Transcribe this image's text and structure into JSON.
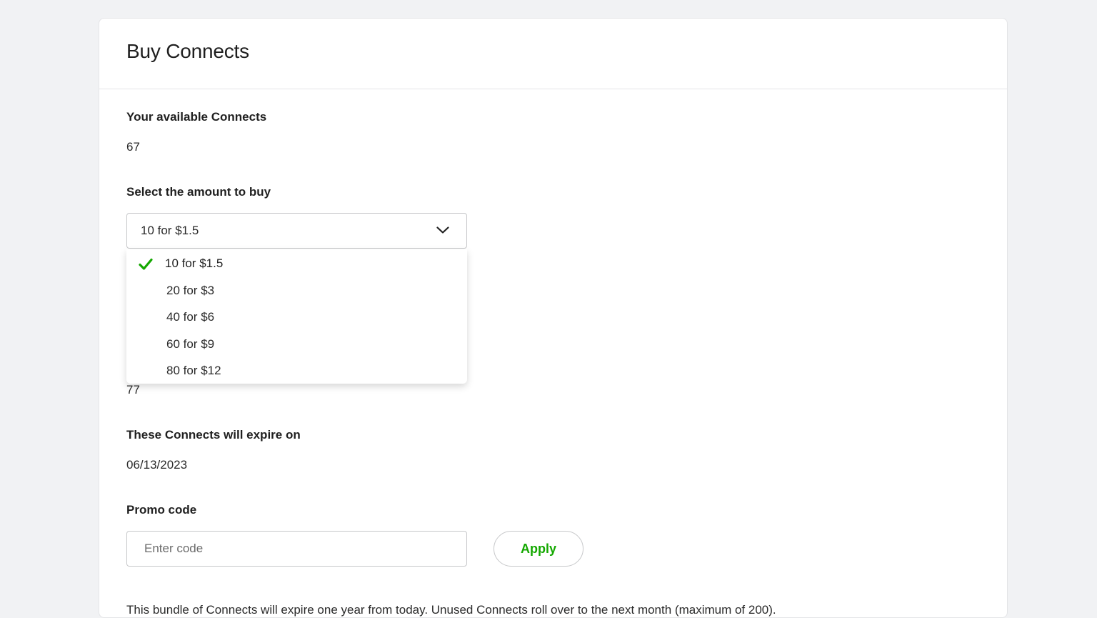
{
  "page": {
    "title": "Buy Connects"
  },
  "available": {
    "label": "Your available Connects",
    "value": "67"
  },
  "amount": {
    "label": "Select the amount to buy",
    "selected": "10 for $1.5",
    "options": [
      {
        "label": "10 for $1.5",
        "selected": true
      },
      {
        "label": "20 for $3",
        "selected": false
      },
      {
        "label": "40 for $6",
        "selected": false
      },
      {
        "label": "60 for $9",
        "selected": false
      },
      {
        "label": "80 for $12",
        "selected": false
      }
    ]
  },
  "new_balance": {
    "value": "77"
  },
  "expiry": {
    "label": "These Connects will expire on",
    "value": "06/13/2023"
  },
  "promo": {
    "label": "Promo code",
    "placeholder": "Enter code",
    "value": "",
    "apply_label": "Apply"
  },
  "footnote": {
    "text": "This bundle of Connects will expire one year from today. Unused Connects roll over to the next month (maximum of 200)."
  },
  "colors": {
    "accent": "#14a800",
    "background": "#f1f2f4",
    "card": "#ffffff",
    "border": "#c7c8ca"
  },
  "icons": {
    "select_chevron": "chevron-down-icon",
    "selected_check": "check-icon"
  }
}
